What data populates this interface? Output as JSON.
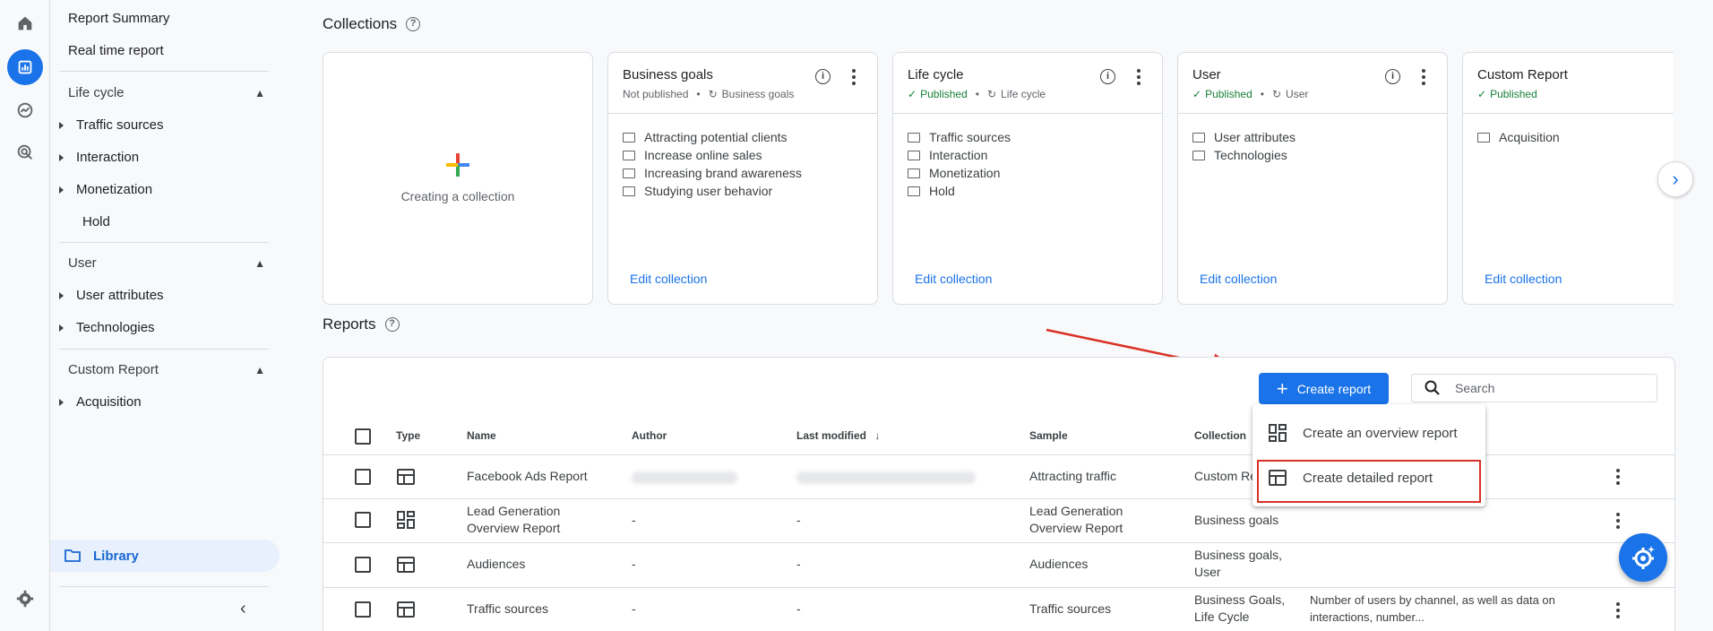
{
  "nav": {
    "report_summary": "Report Summary",
    "realtime": "Real time report",
    "groups": [
      {
        "label": "Life cycle",
        "items": [
          "Traffic sources",
          "Interaction",
          "Monetization",
          "Hold"
        ]
      },
      {
        "label": "User",
        "items": [
          "User attributes",
          "Technologies"
        ]
      },
      {
        "label": "Custom Report",
        "items": [
          "Acquisition"
        ]
      }
    ],
    "library": "Library"
  },
  "collections": {
    "title": "Collections",
    "create_label": "Creating a collection",
    "cards": [
      {
        "title": "Business goals",
        "status": "Not published",
        "source": "Business goals",
        "items": [
          "Attracting potential clients",
          "Increase online sales",
          "Increasing brand awareness",
          "Studying user behavior"
        ],
        "edit": "Edit collection"
      },
      {
        "title": "Life cycle",
        "status": "Published",
        "source": "Life cycle",
        "items": [
          "Traffic sources",
          "Interaction",
          "Monetization",
          "Hold"
        ],
        "edit": "Edit collection"
      },
      {
        "title": "User",
        "status": "Published",
        "source": "User",
        "items": [
          "User attributes",
          "Technologies"
        ],
        "edit": "Edit collection"
      },
      {
        "title": "Custom Report",
        "status": "Published",
        "source": "",
        "items": [
          "Acquisition"
        ],
        "edit": "Edit collection"
      }
    ]
  },
  "reports": {
    "title": "Reports",
    "create_button": "Create report",
    "search_placeholder": "Search",
    "columns": {
      "type": "Type",
      "name": "Name",
      "author": "Author",
      "last_modified": "Last modified",
      "sample": "Sample",
      "collection": "Collection"
    },
    "rows": [
      {
        "type": "table-icon",
        "name": "Facebook Ads Report",
        "author": "",
        "modified": "",
        "sample": "Attracting traffic",
        "collection": "Custom Re",
        "description": ""
      },
      {
        "type": "overview-icon",
        "name": "Lead Generation Overview Report",
        "author": "-",
        "modified": "-",
        "sample": "Lead Generation Overview Report",
        "collection": "Business goals",
        "description": ""
      },
      {
        "type": "table-icon",
        "name": "Audiences",
        "author": "-",
        "modified": "-",
        "sample": "Audiences",
        "collection": "Business goals, User",
        "description": ""
      },
      {
        "type": "table-icon",
        "name": "Traffic sources",
        "author": "-",
        "modified": "-",
        "sample": "Traffic sources",
        "collection": "Business Goals, Life Cycle",
        "description": "Number of users by channel, as well as data on interactions, number..."
      }
    ],
    "menu": {
      "overview": "Create an overview report",
      "detailed": "Create detailed report"
    }
  },
  "colors": {
    "accent": "#1a73e8",
    "published": "#188038",
    "highlight": "#d93025"
  }
}
